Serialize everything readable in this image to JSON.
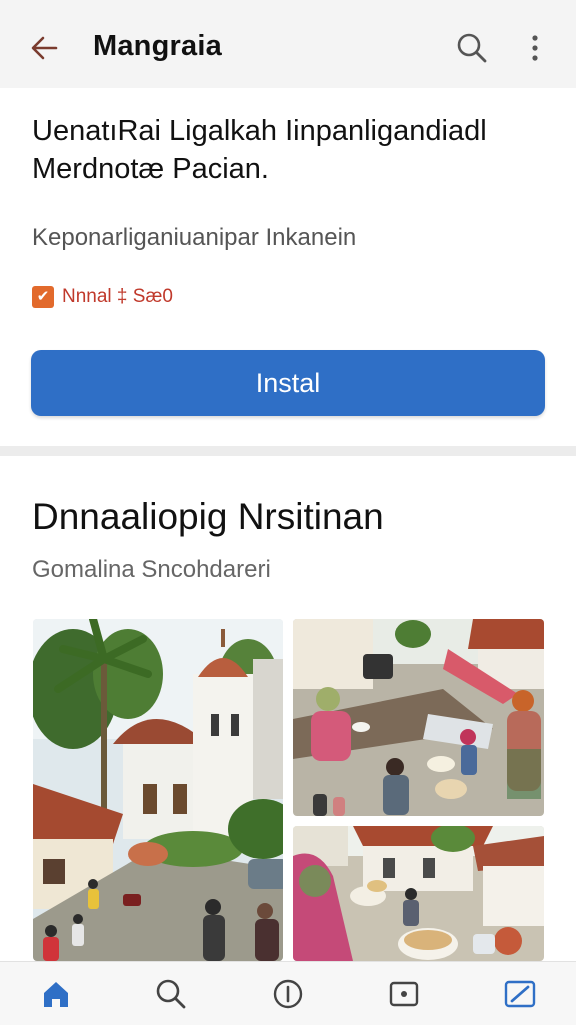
{
  "app_bar": {
    "title": "Mangraia",
    "icons": [
      "back-arrow-icon",
      "search-icon",
      "more-vert-icon"
    ]
  },
  "app_card": {
    "headline": "UenatıRai Ligalkah Iinpanligandiadl Merdnotæ Pacian.",
    "subtitle": "Keponarliganiuanipar Inkanein",
    "badge_icon": "✔",
    "badge_text": "Nnnal ‡ Sæ0",
    "install_label": "Instal",
    "install_color": "#2f6fc6"
  },
  "section": {
    "title": "Dnnaaliopig Nrsitinan",
    "subtitle": "Gomalina Sncohdareri"
  },
  "gallery": {
    "images": [
      "mosque-courtyard-photo",
      "food-sharing-street-photo",
      "women-holding-bowls-photo"
    ]
  },
  "bottom_nav": {
    "items": [
      "home-icon",
      "search-icon",
      "info-icon",
      "media-icon",
      "edit-icon"
    ],
    "active_color": "#2f6fc6"
  }
}
